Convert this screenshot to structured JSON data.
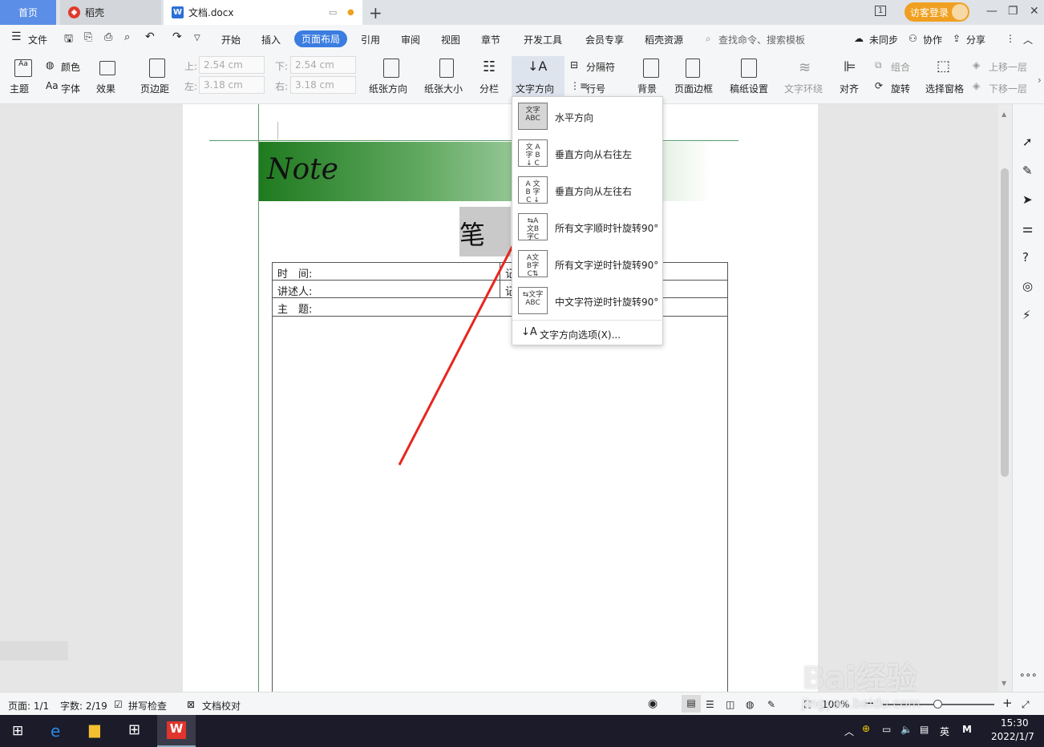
{
  "tabs": {
    "home": "首页",
    "daoke": "稻壳",
    "doc": "文档.docx"
  },
  "titlebar": {
    "login": "访客登录",
    "badge": "1"
  },
  "menu": {
    "file": "文件",
    "items": [
      "开始",
      "插入",
      "页面布局",
      "引用",
      "审阅",
      "视图",
      "章节",
      "开发工具",
      "会员专享",
      "稻壳资源"
    ],
    "search": "查找命令、搜索模板",
    "sync": "未同步",
    "collab": "协作",
    "share": "分享"
  },
  "ribbon": {
    "theme": "主题",
    "color": "颜色",
    "font": "字体",
    "effect": "效果",
    "margin": "页边距",
    "top_label": "上:",
    "top_val": "2.54 cm",
    "bottom_label": "下:",
    "bottom_val": "2.54 cm",
    "left_label": "左:",
    "left_val": "3.18 cm",
    "right_label": "右:",
    "right_val": "3.18 cm",
    "orientation": "纸张方向",
    "size": "纸张大小",
    "columns": "分栏",
    "text_dir": "文字方向",
    "separator": "分隔符",
    "line_num": "行号",
    "background": "背景",
    "page_border": "页面边框",
    "draft": "稿纸设置",
    "text_wrap": "文字环绕",
    "align": "对齐",
    "group": "组合",
    "rotate": "旋转",
    "select_pane": "选择窗格",
    "bring_forward": "上移一层",
    "send_backward": "下移一层"
  },
  "dropdown": {
    "items": [
      {
        "label": "水平方向",
        "icon_text": "文字\nABC"
      },
      {
        "label": "垂直方向从右往左",
        "icon_text": "文ABC"
      },
      {
        "label": "垂直方向从左往右",
        "icon_text": "ABC文"
      },
      {
        "label": "所有文字顺时针旋转90°",
        "icon_text": "ABC"
      },
      {
        "label": "所有文字逆时针旋转90°",
        "icon_text": "ABC"
      },
      {
        "label": "中文字符逆时针旋转90°",
        "icon_text": "ABC"
      }
    ],
    "options": "文字方向选项(X)..."
  },
  "doc": {
    "note": "Note",
    "title_char": "笔",
    "row1": "时　间:",
    "row2": "讲述人:",
    "row3": "主　题:",
    "row1_right": "记",
    "row2_right": "记"
  },
  "status": {
    "page": "页面: 1/1",
    "words": "字数: 2/19",
    "spell": "拼写检查",
    "proof": "文档校对",
    "zoom": "100%"
  },
  "taskbar": {
    "time": "15:30",
    "date": "2022/1/7",
    "ime": "英"
  },
  "watermark": {
    "brand": "Bai经验",
    "url": "jingyan.baidu.com"
  }
}
